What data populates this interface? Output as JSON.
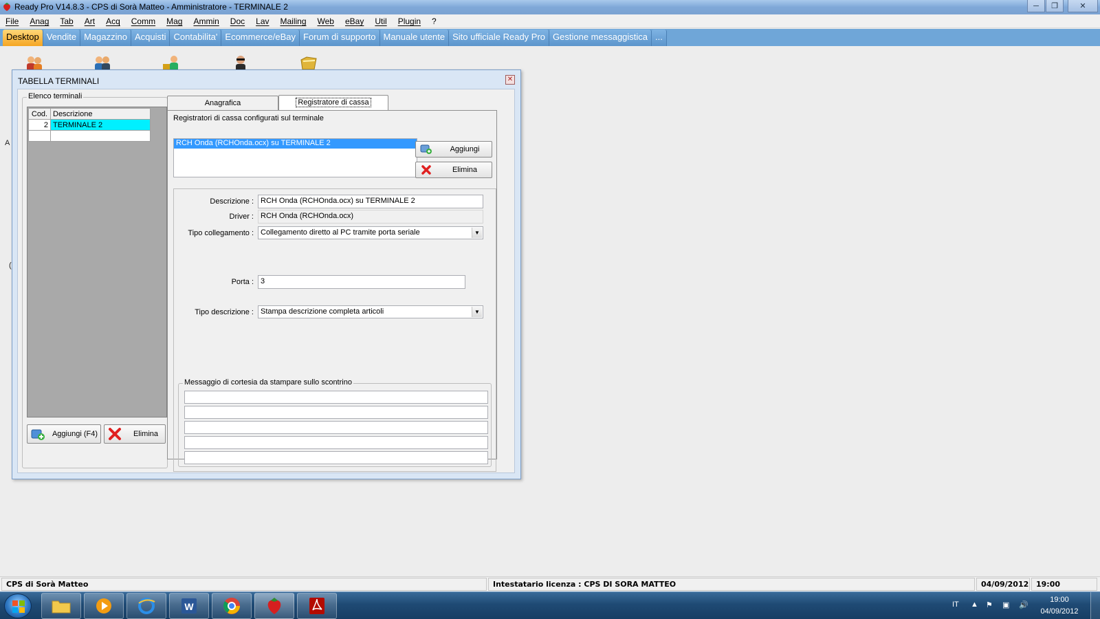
{
  "window": {
    "title": "Ready Pro V14.8.3 - CPS di Sorà Matteo - Amministratore - TERMINALE 2",
    "minimize": "─",
    "restore": "❐",
    "close": "✕"
  },
  "menu": [
    "File",
    "Anag",
    "Tab",
    "Art",
    "Acq",
    "Comm",
    "Mag",
    "Ammin",
    "Doc",
    "Lav",
    "Mailing",
    "Web",
    "eBay",
    "Util",
    "Plugin",
    "?"
  ],
  "tabs": [
    "Desktop",
    "Vendite",
    "Magazzino",
    "Acquisti",
    "Contabilita'",
    "Ecommerce/eBay",
    "Forum di supporto",
    "Manuale utente",
    "Sito ufficiale Ready Pro",
    "Gestione messaggistica",
    "..."
  ],
  "desktop_icons": [
    "users-icon",
    "clients-icon",
    "suppliers-icon",
    "agent-icon",
    "folder-icon"
  ],
  "desktop_edge_text": [
    "A",
    "("
  ],
  "dialog": {
    "title": "TABELLA TERMINALI",
    "list_group_label": "Elenco terminali",
    "grid": {
      "columns": [
        "Cod.",
        "Descrizione"
      ],
      "rows": [
        {
          "code": "2",
          "description": "TERMINALE 2"
        }
      ]
    },
    "add_button": "Aggiungi (F4)",
    "delete_button": "Elimina",
    "tabs": [
      "Anagrafica",
      "Registratore di cassa"
    ],
    "active_tab": "Registratore di cassa",
    "registers_label": "Registratori di cassa configurati sul terminale",
    "registers": [
      "RCH Onda (RCHOnda.ocx) su TERMINALE 2"
    ],
    "reg_add_button": "Aggiungi",
    "reg_delete_button": "Elimina",
    "form": {
      "descrizione_label": "Descrizione :",
      "descrizione_value": "RCH Onda (RCHOnda.ocx) su TERMINALE 2",
      "driver_label": "Driver :",
      "driver_value": "RCH Onda (RCHOnda.ocx)",
      "tipo_collegamento_label": "Tipo collegamento :",
      "tipo_collegamento_value": "Collegamento diretto al PC tramite porta seriale",
      "porta_label": "Porta :",
      "porta_value": "3",
      "tipo_descrizione_label": "Tipo descrizione :",
      "tipo_descrizione_value": "Stampa descrizione completa articoli",
      "messaggio_label": "Messaggio di cortesia da stampare sullo scontrino",
      "messaggio_lines": [
        "",
        "",
        "",
        "",
        ""
      ]
    }
  },
  "statusbar": {
    "company": "CPS di Sorà Matteo",
    "license": "Intestatario licenza : CPS DI SORA MATTEO",
    "date": "04/09/2012",
    "time": "19:00"
  },
  "taskbar": {
    "apps": [
      "explorer-folder-icon",
      "media-player-icon",
      "internet-explorer-icon",
      "word-icon",
      "chrome-icon",
      "ready-pro-icon",
      "acrobat-icon"
    ],
    "language": "IT",
    "clock_time": "19:00",
    "clock_date": "04/09/2012"
  },
  "colors": {
    "selection_cyan": "#00f0ff",
    "selection_blue": "#3399ff",
    "active_tab_orange": "#f5a623",
    "tab_blue": "#6fa6d8"
  }
}
